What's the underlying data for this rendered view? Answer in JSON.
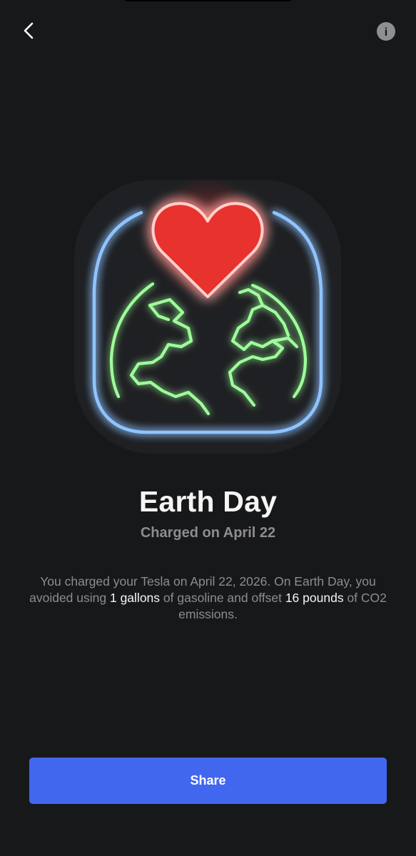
{
  "nav": {
    "back_icon": "chevron-left-icon",
    "info_icon": "info-icon",
    "info_glyph": "i"
  },
  "badge": {
    "icons": [
      "heart-icon",
      "globe-icon"
    ],
    "colors": {
      "frame": "#5aa8ff",
      "heart": "#ff3b3b",
      "globe": "#4dff5a"
    }
  },
  "title": "Earth Day",
  "subtitle": "Charged on April 22",
  "body": {
    "part1": "You charged your Tesla on April 22, 2026. On Earth Day, you avoided using ",
    "gallons": "1 gallons",
    "part2": " of gasoline and offset ",
    "pounds": "16 pounds",
    "part3": " of CO2 emissions."
  },
  "share_label": "Share",
  "colors": {
    "background": "#17181a",
    "accent": "#4167ef"
  }
}
